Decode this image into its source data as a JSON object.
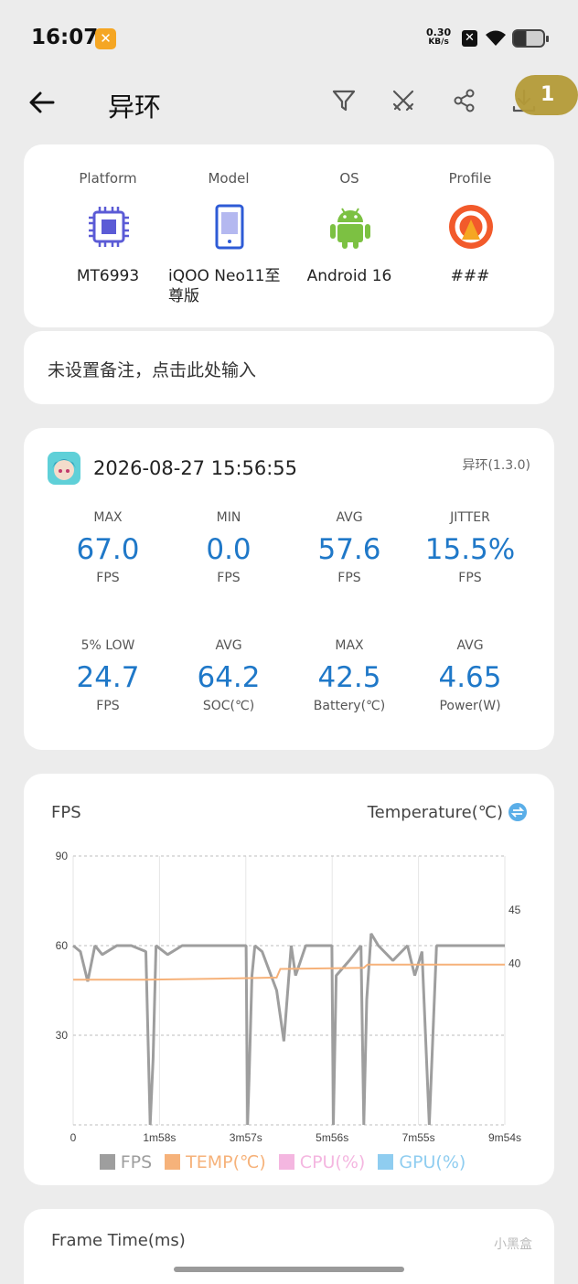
{
  "status_bar": {
    "time": "16:07",
    "speed_value": "0.30",
    "speed_unit": "KB/s"
  },
  "header": {
    "title": "异环",
    "download_badge": "1"
  },
  "device": {
    "items": [
      {
        "label": "Platform",
        "value": "MT6993",
        "icon": "chip-icon",
        "color": "#5b5bd6"
      },
      {
        "label": "Model",
        "value": "iQOO Neo11至尊版",
        "icon": "phone-icon",
        "color": "#2e5bd6"
      },
      {
        "label": "OS",
        "value": "Android 16",
        "icon": "android-icon",
        "color": "#7cc142"
      },
      {
        "label": "Profile",
        "value": "###",
        "icon": "profile-icon",
        "color": "#f25a2b"
      }
    ]
  },
  "note": {
    "placeholder": "未设置备注，点击此处输入"
  },
  "session": {
    "datetime": "2026-08-27 15:56:55",
    "version": "异环(1.3.0)"
  },
  "stats": [
    {
      "label": "MAX",
      "value": "67.0",
      "unit": "FPS"
    },
    {
      "label": "MIN",
      "value": "0.0",
      "unit": "FPS"
    },
    {
      "label": "AVG",
      "value": "57.6",
      "unit": "FPS"
    },
    {
      "label": "JITTER",
      "value": "15.5%",
      "unit": "FPS"
    },
    {
      "label": "5% LOW",
      "value": "24.7",
      "unit": "FPS"
    },
    {
      "label": "AVG",
      "value": "64.2",
      "unit": "SOC(℃)"
    },
    {
      "label": "MAX",
      "value": "42.5",
      "unit": "Battery(℃)"
    },
    {
      "label": "AVG",
      "value": "4.65",
      "unit": "Power(W)"
    }
  ],
  "chart_data": {
    "type": "line",
    "ylabel_left": "FPS",
    "ylabel_right": "Temperature(℃)",
    "x_ticks": [
      "0",
      "1m58s",
      "3m57s",
      "5m56s",
      "7m55s",
      "9m54s"
    ],
    "y_ticks_left": [
      "90",
      "60",
      "30"
    ],
    "y_ticks_right": [
      "45",
      "40"
    ],
    "ylim_left": [
      0,
      90
    ],
    "ylim_right": [
      25,
      50
    ],
    "grid": true,
    "legend_position": "bottom",
    "series": [
      {
        "name": "FPS",
        "color": "#9e9e9e",
        "x_seconds": [
          0,
          10,
          20,
          30,
          40,
          60,
          80,
          100,
          106,
          110,
          114,
          130,
          150,
          170,
          180,
          200,
          238,
          240,
          242,
          246,
          250,
          260,
          280,
          290,
          300,
          306,
          320,
          340,
          356,
          358,
          362,
          380,
          396,
          400,
          404,
          410,
          420,
          440,
          460,
          470,
          480,
          490,
          500,
          530,
          560,
          594
        ],
        "values": [
          60,
          58,
          48,
          60,
          57,
          60,
          60,
          58,
          0,
          22,
          60,
          57,
          60,
          60,
          60,
          60,
          60,
          0,
          15,
          50,
          60,
          58,
          45,
          28,
          60,
          50,
          60,
          60,
          60,
          0,
          50,
          55,
          60,
          0,
          42,
          64,
          60,
          55,
          60,
          50,
          58,
          0,
          60,
          60,
          60,
          60
        ]
      },
      {
        "name": "TEMP(℃)",
        "color": "#f6b27a",
        "x_seconds": [
          0,
          100,
          200,
          280,
          285,
          400,
          405,
          594
        ],
        "values": [
          38.5,
          38.5,
          38.6,
          38.7,
          39.5,
          39.6,
          39.9,
          39.9
        ]
      }
    ],
    "legend": [
      {
        "name": "FPS",
        "color": "#9e9e9e"
      },
      {
        "name": "TEMP(℃)",
        "color": "#f6b27a"
      },
      {
        "name": "CPU(%)",
        "color": "#f4b6e0"
      },
      {
        "name": "GPU(%)",
        "color": "#8fcdf0"
      }
    ]
  },
  "frame_time": {
    "title": "Frame Time(ms)"
  },
  "watermark": "小黑盒"
}
